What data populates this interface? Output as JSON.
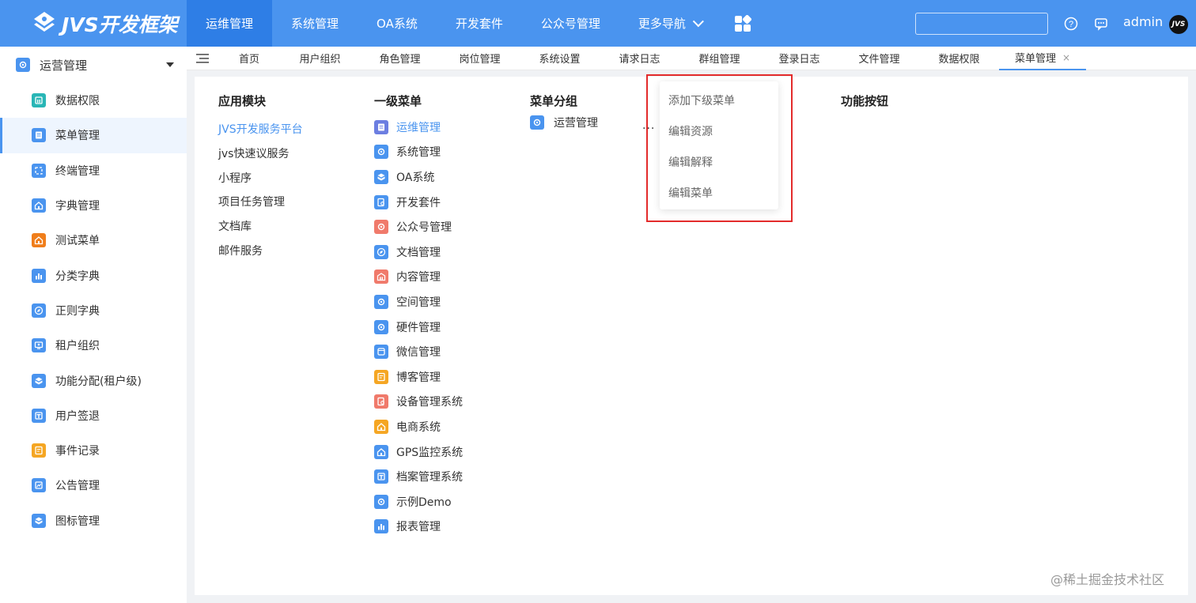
{
  "header": {
    "logo_text": "JVS开发框架",
    "nav": [
      "运维管理",
      "系统管理",
      "OA系统",
      "开发套件",
      "公众号管理",
      "更多导航"
    ],
    "active_nav_index": 0,
    "username": "admin",
    "avatar_text": "JVS",
    "search_value": ""
  },
  "sidebar": {
    "group_label": "运营管理",
    "items": [
      {
        "label": "数据权限",
        "icon": "database-icon",
        "color": "#29b6b6"
      },
      {
        "label": "菜单管理",
        "icon": "menu-doc-icon",
        "color": "#4a94ef"
      },
      {
        "label": "终端管理",
        "icon": "terminal-icon",
        "color": "#4a94ef"
      },
      {
        "label": "字典管理",
        "icon": "home-icon",
        "color": "#4a94ef"
      },
      {
        "label": "测试菜单",
        "icon": "home-icon",
        "color": "#f07e1b"
      },
      {
        "label": "分类字典",
        "icon": "bar-chart-icon",
        "color": "#4a94ef"
      },
      {
        "label": "正则字典",
        "icon": "compass-icon",
        "color": "#4a94ef"
      },
      {
        "label": "租户组织",
        "icon": "org-icon",
        "color": "#4a94ef"
      },
      {
        "label": "功能分配(租户级)",
        "icon": "box-icon",
        "color": "#4a94ef"
      },
      {
        "label": "用户签退",
        "icon": "logout-icon",
        "color": "#4a94ef"
      },
      {
        "label": "事件记录",
        "icon": "record-icon",
        "color": "#f5a623"
      },
      {
        "label": "公告管理",
        "icon": "notice-icon",
        "color": "#4a94ef"
      },
      {
        "label": "图标管理",
        "icon": "box-icon",
        "color": "#4a94ef"
      }
    ],
    "active_index": 1
  },
  "tabs": {
    "items": [
      "首页",
      "用户组织",
      "角色管理",
      "岗位管理",
      "系统设置",
      "请求日志",
      "群组管理",
      "登录日志",
      "文件管理",
      "数据权限",
      "菜单管理"
    ],
    "active_index": 10,
    "close_symbol": "×"
  },
  "content": {
    "app_title": "应用模块",
    "apps": [
      "JVS开发服务平台",
      "jvs快速议服务",
      "小程序",
      "项目任务管理",
      "文档库",
      "邮件服务"
    ],
    "active_app_index": 0,
    "menu_title": "一级菜单",
    "menus": [
      {
        "label": "运维管理",
        "icon": "doc-icon",
        "color": "#6c7ee1"
      },
      {
        "label": "系统管理",
        "icon": "gear-icon",
        "color": "#4a94ef"
      },
      {
        "label": "OA系统",
        "icon": "box-icon",
        "color": "#4a94ef"
      },
      {
        "label": "开发套件",
        "icon": "search-doc-icon",
        "color": "#4a94ef"
      },
      {
        "label": "公众号管理",
        "icon": "gear-icon",
        "color": "#f07a6b"
      },
      {
        "label": "文档管理",
        "icon": "compass-icon",
        "color": "#4a94ef"
      },
      {
        "label": "内容管理",
        "icon": "building-icon",
        "color": "#f07a6b"
      },
      {
        "label": "空间管理",
        "icon": "gear-icon",
        "color": "#4a94ef"
      },
      {
        "label": "硬件管理",
        "icon": "gear-icon",
        "color": "#4a94ef"
      },
      {
        "label": "微信管理",
        "icon": "window-icon",
        "color": "#4a94ef"
      },
      {
        "label": "博客管理",
        "icon": "record-icon",
        "color": "#f5a623"
      },
      {
        "label": "设备管理系统",
        "icon": "search-doc-icon",
        "color": "#f07a6b"
      },
      {
        "label": "电商系统",
        "icon": "home-icon",
        "color": "#f5a623"
      },
      {
        "label": "GPS监控系统",
        "icon": "home-icon",
        "color": "#4a94ef"
      },
      {
        "label": "档案管理系统",
        "icon": "logout-icon",
        "color": "#4a94ef"
      },
      {
        "label": "示例Demo",
        "icon": "gear-icon",
        "color": "#4a94ef"
      },
      {
        "label": "报表管理",
        "icon": "bar-chart-icon",
        "color": "#4a94ef"
      }
    ],
    "active_menu_index": 0,
    "group_title": "菜单分组",
    "group_item": "运营管理",
    "more_label": "···",
    "button_title": "功能按钮",
    "dropdown": [
      "添加下级菜单",
      "编辑资源",
      "编辑解释",
      "编辑菜单"
    ],
    "highlight_color": "#e32b2b"
  },
  "watermark": "@稀土掘金技术社区"
}
